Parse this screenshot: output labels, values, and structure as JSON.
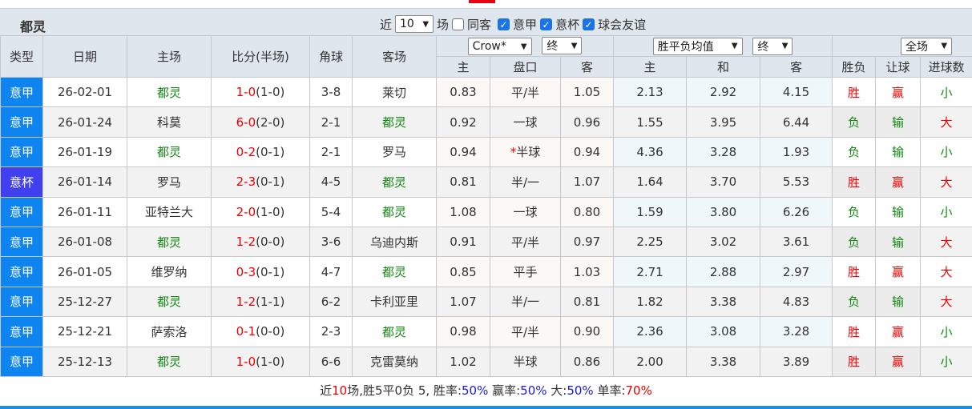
{
  "team": "都灵",
  "filters": {
    "recent_prefix": "近",
    "recent_value": "10",
    "recent_suffix": "场",
    "same_venue": "同客",
    "leagues": [
      {
        "label": "意甲",
        "checked": true
      },
      {
        "label": "意杯",
        "checked": true
      },
      {
        "label": "球会友谊",
        "checked": true
      }
    ]
  },
  "headers": {
    "type": "类型",
    "date": "日期",
    "home": "主场",
    "score": "比分(半场)",
    "corner": "角球",
    "away": "客场",
    "ah_company": "Crow*",
    "ah_time": "终",
    "eu_kind": "胜平负均值",
    "eu_time": "终",
    "scope": "全场",
    "ah_home": "主",
    "ah_line": "盘口",
    "ah_away": "客",
    "eu_home": "主",
    "eu_draw": "和",
    "eu_away": "客",
    "result": "胜负",
    "handicap": "让球",
    "goals": "进球数"
  },
  "rows": [
    {
      "type": "意甲",
      "date": "26-02-01",
      "home": "都灵",
      "score": "1-0",
      "half": "(1-0)",
      "corner": "3-8",
      "away": "莱切",
      "ah_h": "0.83",
      "line": "平/半",
      "star": "",
      "ah_a": "1.05",
      "eu_h": "2.13",
      "eu_d": "2.92",
      "eu_a": "4.15",
      "res": "胜",
      "hc": "赢",
      "goals": "小",
      "team_home": true
    },
    {
      "type": "意甲",
      "date": "26-01-24",
      "home": "科莫",
      "score": "6-0",
      "half": "(2-0)",
      "corner": "2-1",
      "away": "都灵",
      "ah_h": "0.92",
      "line": "一球",
      "star": "",
      "ah_a": "0.96",
      "eu_h": "1.55",
      "eu_d": "3.95",
      "eu_a": "6.44",
      "res": "负",
      "hc": "输",
      "goals": "大",
      "team_home": false
    },
    {
      "type": "意甲",
      "date": "26-01-19",
      "home": "都灵",
      "score": "0-2",
      "half": "(0-1)",
      "corner": "2-1",
      "away": "罗马",
      "ah_h": "0.94",
      "line": "半球",
      "star": "*",
      "ah_a": "0.94",
      "eu_h": "4.36",
      "eu_d": "3.28",
      "eu_a": "1.93",
      "res": "负",
      "hc": "输",
      "goals": "小",
      "team_home": true
    },
    {
      "type": "意杯",
      "date": "26-01-14",
      "home": "罗马",
      "score": "2-3",
      "half": "(0-1)",
      "corner": "4-5",
      "away": "都灵",
      "ah_h": "0.81",
      "line": "半/一",
      "star": "",
      "ah_a": "1.07",
      "eu_h": "1.64",
      "eu_d": "3.70",
      "eu_a": "5.53",
      "res": "胜",
      "hc": "赢",
      "goals": "大",
      "team_home": false
    },
    {
      "type": "意甲",
      "date": "26-01-11",
      "home": "亚特兰大",
      "score": "2-0",
      "half": "(1-0)",
      "corner": "5-4",
      "away": "都灵",
      "ah_h": "1.08",
      "line": "一球",
      "star": "",
      "ah_a": "0.80",
      "eu_h": "1.59",
      "eu_d": "3.80",
      "eu_a": "6.26",
      "res": "负",
      "hc": "输",
      "goals": "小",
      "team_home": false
    },
    {
      "type": "意甲",
      "date": "26-01-08",
      "home": "都灵",
      "score": "1-2",
      "half": "(0-0)",
      "corner": "3-6",
      "away": "乌迪内斯",
      "ah_h": "0.91",
      "line": "平/半",
      "star": "",
      "ah_a": "0.97",
      "eu_h": "2.25",
      "eu_d": "3.02",
      "eu_a": "3.61",
      "res": "负",
      "hc": "输",
      "goals": "大",
      "team_home": true
    },
    {
      "type": "意甲",
      "date": "26-01-05",
      "home": "维罗纳",
      "score": "0-3",
      "half": "(0-1)",
      "corner": "4-7",
      "away": "都灵",
      "ah_h": "0.85",
      "line": "平手",
      "star": "",
      "ah_a": "1.03",
      "eu_h": "2.71",
      "eu_d": "2.88",
      "eu_a": "2.97",
      "res": "胜",
      "hc": "赢",
      "goals": "大",
      "team_home": false
    },
    {
      "type": "意甲",
      "date": "25-12-27",
      "home": "都灵",
      "score": "1-2",
      "half": "(1-1)",
      "corner": "6-2",
      "away": "卡利亚里",
      "ah_h": "1.07",
      "line": "半/一",
      "star": "",
      "ah_a": "0.81",
      "eu_h": "1.82",
      "eu_d": "3.38",
      "eu_a": "4.83",
      "res": "负",
      "hc": "输",
      "goals": "大",
      "team_home": true
    },
    {
      "type": "意甲",
      "date": "25-12-21",
      "home": "萨索洛",
      "score": "0-1",
      "half": "(0-0)",
      "corner": "2-3",
      "away": "都灵",
      "ah_h": "0.98",
      "line": "平/半",
      "star": "",
      "ah_a": "0.90",
      "eu_h": "2.36",
      "eu_d": "3.08",
      "eu_a": "3.28",
      "res": "胜",
      "hc": "赢",
      "goals": "小",
      "team_home": false
    },
    {
      "type": "意甲",
      "date": "25-12-13",
      "home": "都灵",
      "score": "1-0",
      "half": "(1-0)",
      "corner": "6-6",
      "away": "克雷莫纳",
      "ah_h": "1.02",
      "line": "半球",
      "star": "",
      "ah_a": "0.86",
      "eu_h": "2.00",
      "eu_d": "3.38",
      "eu_a": "3.89",
      "res": "胜",
      "hc": "赢",
      "goals": "小",
      "team_home": true
    }
  ],
  "summary": {
    "p1": "近",
    "n": "10",
    "p2": "场,胜5平0负 5, 胜率:",
    "win_rate": "50%",
    "p3": " 赢率:",
    "cover_rate": "50%",
    "p4": " 大:",
    "over_rate": "50%",
    "p5": " 单率:",
    "odd_rate": "70%"
  },
  "colors": {
    "win": "#e00",
    "lose": "#118811",
    "league": "#0d84f0",
    "cup": "#4040f0"
  }
}
